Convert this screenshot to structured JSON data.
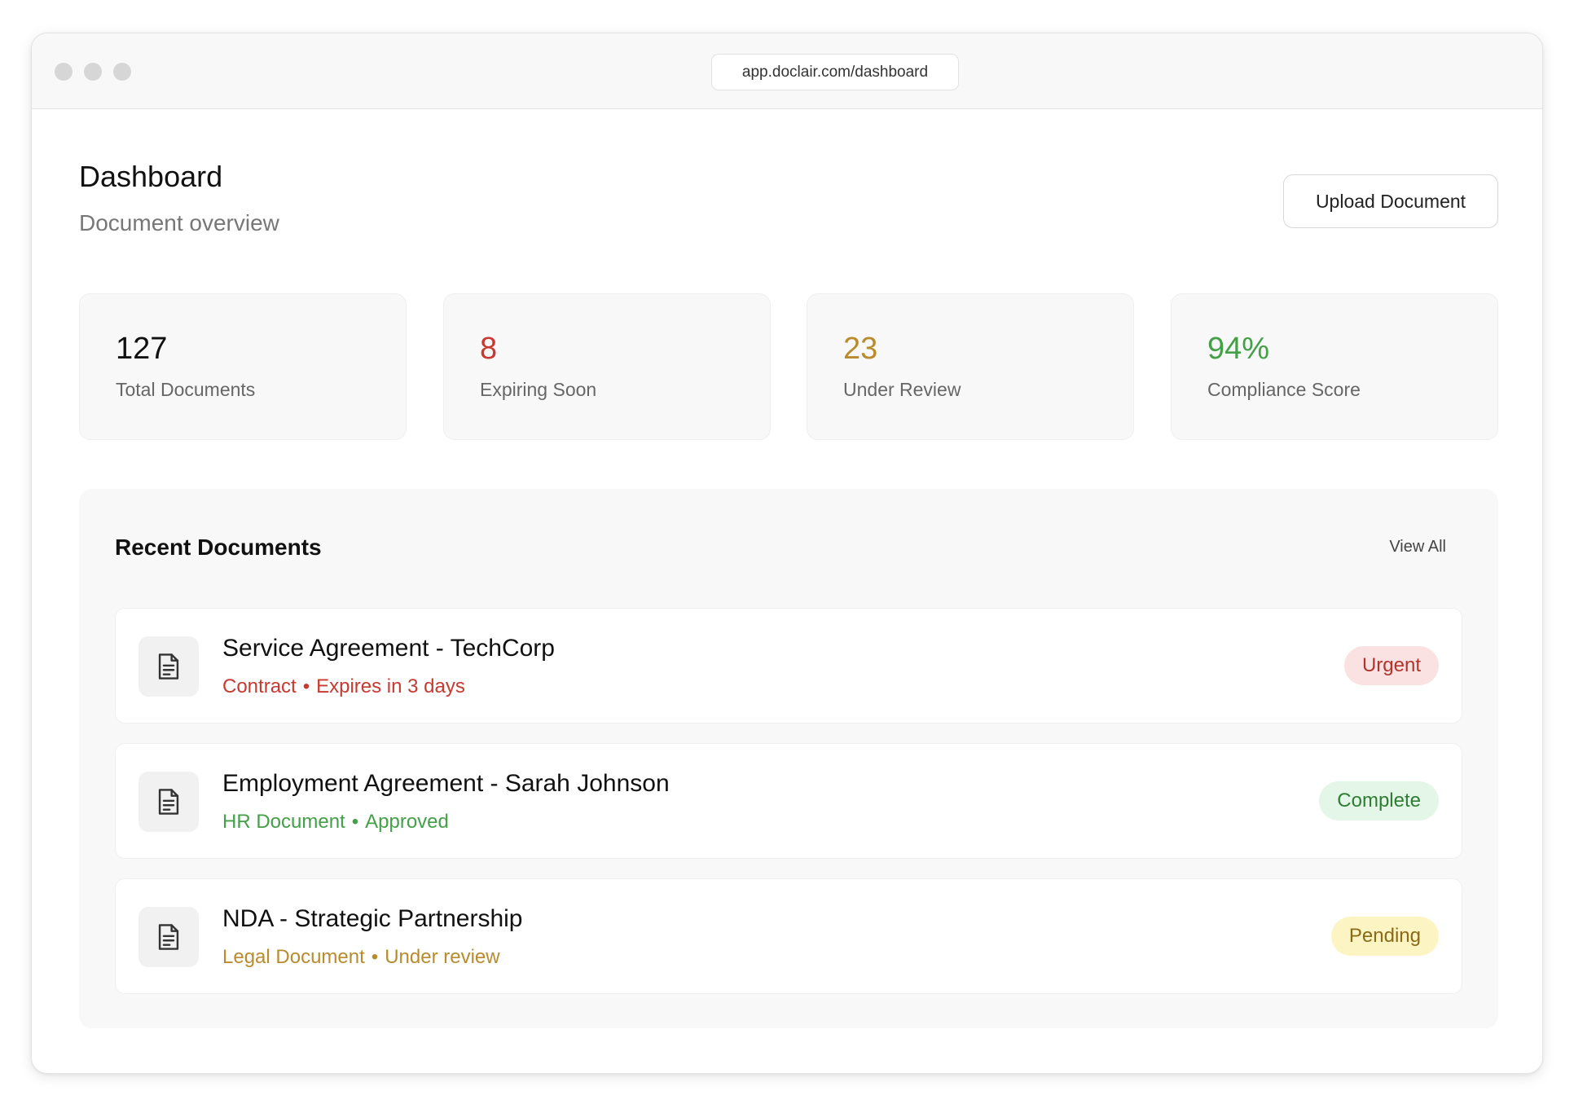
{
  "browser": {
    "url": "app.doclair.com/dashboard"
  },
  "header": {
    "title": "Dashboard",
    "subtitle": "Document overview",
    "upload_label": "Upload Document"
  },
  "stats": [
    {
      "value": "127",
      "label": "Total Documents",
      "color": "#111111"
    },
    {
      "value": "8",
      "label": "Expiring Soon",
      "color": "#c63a2f"
    },
    {
      "value": "23",
      "label": "Under Review",
      "color": "#b98b2d"
    },
    {
      "value": "94%",
      "label": "Compliance Score",
      "color": "#43a047"
    }
  ],
  "recent": {
    "title": "Recent Documents",
    "view_all_label": "View All",
    "documents": [
      {
        "name": "Service Agreement - TechCorp",
        "type": "Contract",
        "status_text": "Expires in 3 days",
        "meta_color": "#c63a2f",
        "badge": "Urgent",
        "badge_bg": "#fbe2e2",
        "badge_color": "#b3332a",
        "icon": "document-icon"
      },
      {
        "name": "Employment Agreement - Sarah Johnson",
        "type": "HR Document",
        "status_text": "Approved",
        "meta_color": "#43a047",
        "badge": "Complete",
        "badge_bg": "#e4f6e8",
        "badge_color": "#2e7d32",
        "icon": "document-icon"
      },
      {
        "name": "NDA - Strategic Partnership",
        "type": "Legal Document",
        "status_text": "Under review",
        "meta_color": "#b98b2d",
        "badge": "Pending",
        "badge_bg": "#fdf4c4",
        "badge_color": "#8a6a14",
        "icon": "document-icon"
      }
    ]
  }
}
